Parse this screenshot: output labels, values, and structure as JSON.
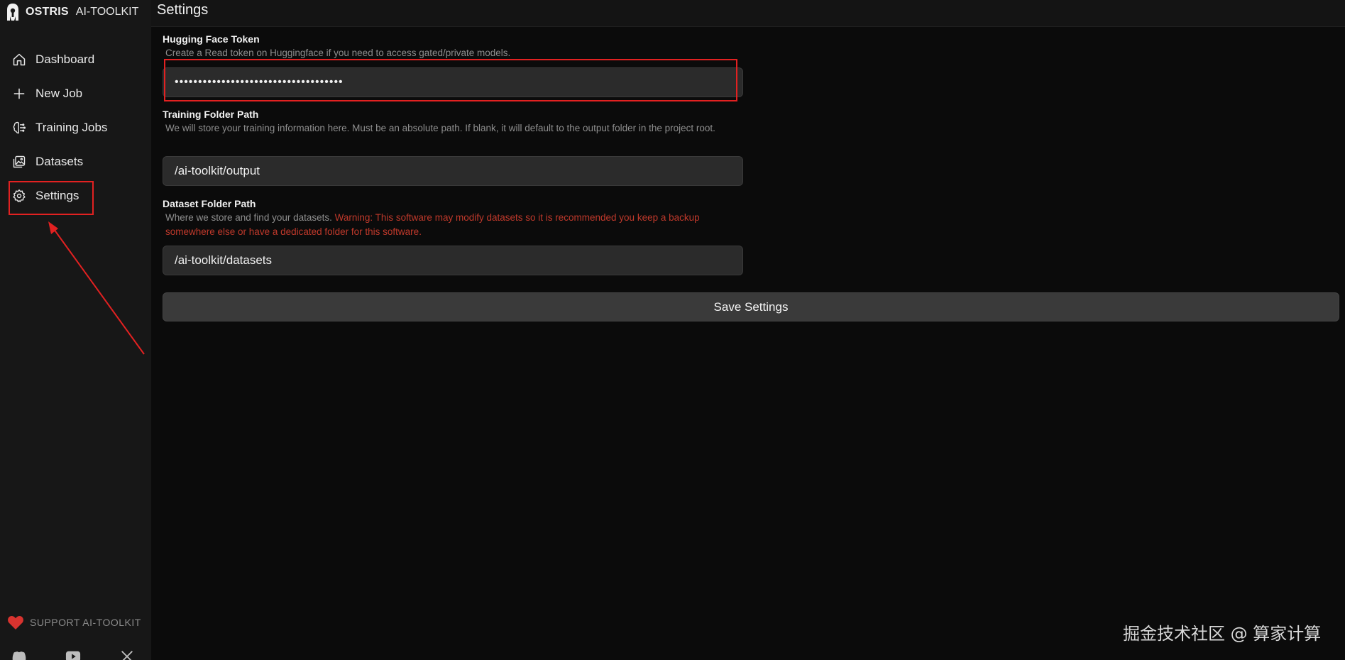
{
  "app": {
    "brand_name": "OSTRIS",
    "brand_sub": "AI-TOOLKIT",
    "page_title": "Settings"
  },
  "sidebar": {
    "items": [
      {
        "label": "Dashboard",
        "icon": "home-icon"
      },
      {
        "label": "New Job",
        "icon": "plus-icon"
      },
      {
        "label": "Training Jobs",
        "icon": "brain-icon"
      },
      {
        "label": "Datasets",
        "icon": "images-icon"
      },
      {
        "label": "Settings",
        "icon": "gear-icon"
      }
    ],
    "support_label": "SUPPORT AI-TOOLKIT",
    "socials": [
      "discord-icon",
      "youtube-icon",
      "x-icon"
    ]
  },
  "settings": {
    "hf_token": {
      "label": "Hugging Face Token",
      "description": "Create a Read token on Huggingface if you need to access gated/private models.",
      "value": "••••••••••••••••••••••••••••••••••••"
    },
    "training_folder": {
      "label": "Training Folder Path",
      "description": "We will store your training information here. Must be an absolute path. If blank, it will default to the output folder in the project root.",
      "value": "/ai-toolkit/output"
    },
    "dataset_folder": {
      "label": "Dataset Folder Path",
      "description": "Where we store and find your datasets.",
      "warning": "Warning: This software may modify datasets so it is recommended you keep a backup somewhere else or have a dedicated folder for this software.",
      "value": "/ai-toolkit/datasets"
    },
    "save_label": "Save Settings"
  },
  "watermark": "掘金技术社区 @ 算家计算",
  "colors": {
    "annotation": "#e22121",
    "warning": "#c0392b",
    "heart": "#d8332f"
  }
}
